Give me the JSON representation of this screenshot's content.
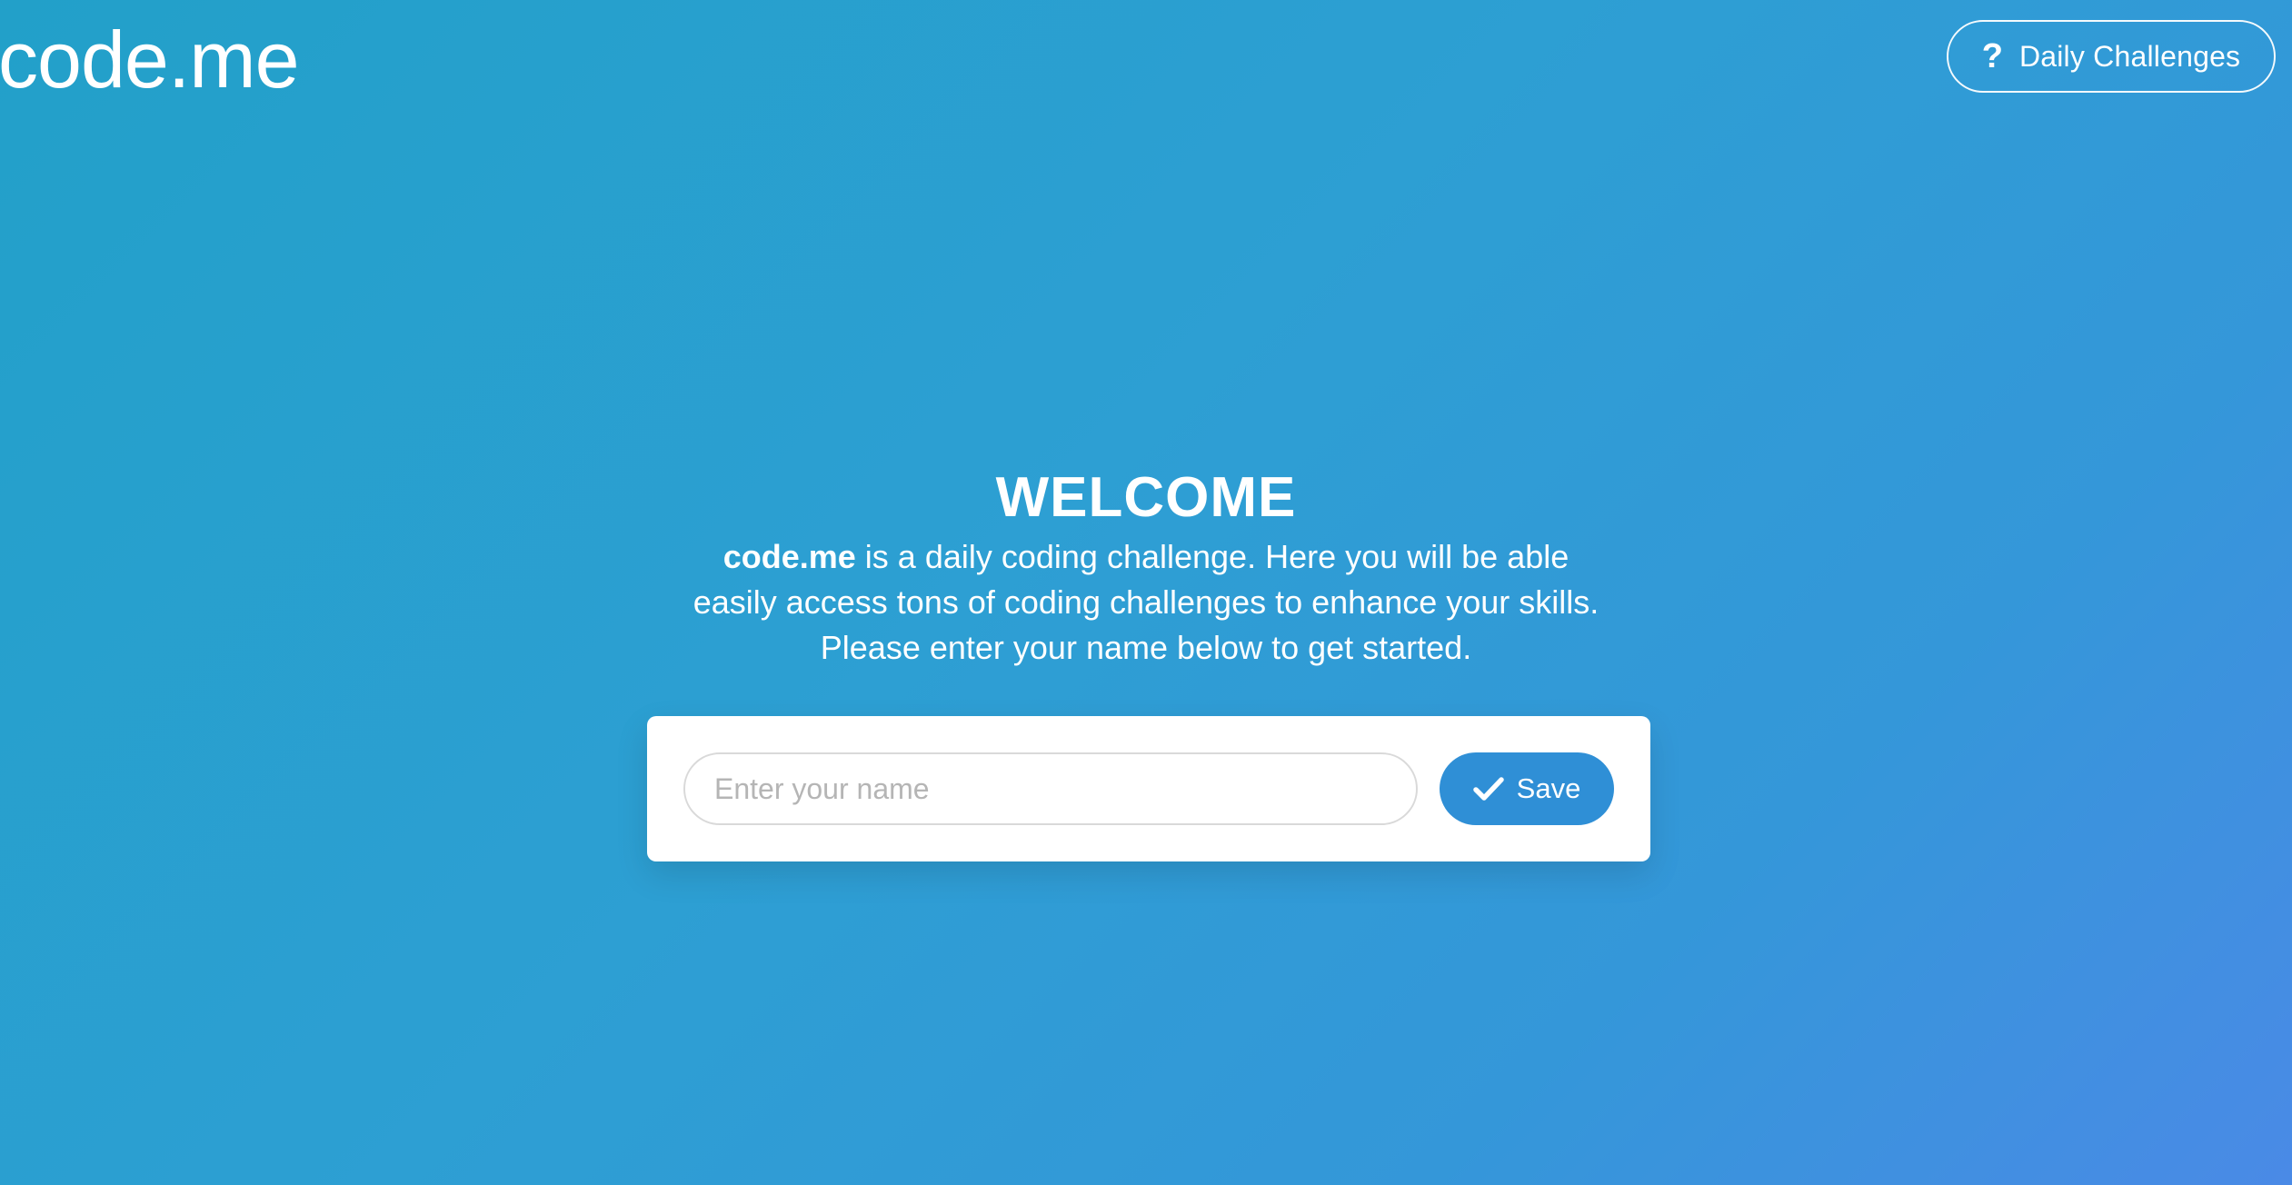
{
  "header": {
    "logo": "code.me",
    "daily_challenges_label": "Daily Challenges",
    "daily_challenges_icon": "question-icon"
  },
  "welcome": {
    "title": "WELCOME",
    "brand": "code.me",
    "line1_rest": " is a daily coding challenge. Here you will be able",
    "line2": "easily access tons of coding challenges to enhance your skills.",
    "line3": "Please enter your name below to get started."
  },
  "form": {
    "name_input": {
      "placeholder": "Enter your name",
      "value": ""
    },
    "save_label": "Save",
    "save_icon": "check-icon"
  },
  "colors": {
    "background_start": "#22a0c9",
    "background_end": "#4a8ae6",
    "accent": "#2f8fd6",
    "card": "#ffffff"
  }
}
